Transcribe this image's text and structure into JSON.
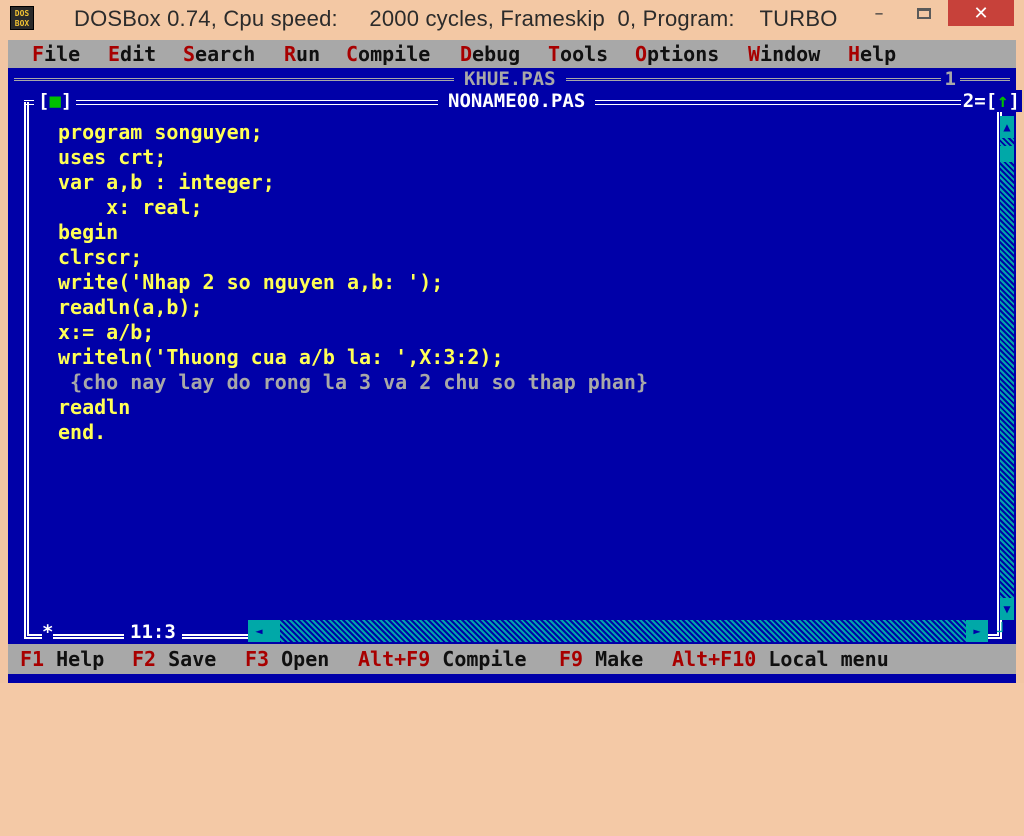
{
  "titlebar": {
    "icon_text": "DOS\nBOX",
    "title": "DOSBox 0.74, Cpu speed:     2000 cycles, Frameskip  0, Program:    TURBO",
    "minimize_label": "–",
    "close_label": "✕"
  },
  "menu": [
    {
      "hot": "F",
      "rest": "ile"
    },
    {
      "hot": "E",
      "rest": "dit"
    },
    {
      "hot": "S",
      "rest": "earch"
    },
    {
      "hot": "R",
      "rest": "un"
    },
    {
      "hot": "C",
      "rest": "ompile"
    },
    {
      "hot": "D",
      "rest": "ebug"
    },
    {
      "hot": "T",
      "rest": "ools"
    },
    {
      "hot": "O",
      "rest": "ptions"
    },
    {
      "hot": "W",
      "rest": "indow"
    },
    {
      "hot": "H",
      "rest": "elp"
    }
  ],
  "back_window": {
    "title": "KHUE.PAS",
    "number": "1"
  },
  "editor": {
    "close_box_left": "[",
    "close_box_mark": "■",
    "close_box_right": "]",
    "title": "NONAME00.PAS",
    "window_number": "2",
    "zoom_left": "[",
    "zoom_mark": "↑",
    "zoom_right": "]",
    "cursor_position": "11:3",
    "modified_marker": "*",
    "code_lines": [
      {
        "text": "program songuyen;",
        "comment": false
      },
      {
        "text": "uses crt;",
        "comment": false
      },
      {
        "text": "var a,b : integer;",
        "comment": false
      },
      {
        "text": "    x: real;",
        "comment": false
      },
      {
        "text": "begin",
        "comment": false
      },
      {
        "text": "clrscr;",
        "comment": false
      },
      {
        "text": "write('Nhap 2 so nguyen a,b: ');",
        "comment": false
      },
      {
        "text": "readln(a,b);",
        "comment": false
      },
      {
        "text": "x:= a/b;",
        "comment": false
      },
      {
        "text": "writeln('Thuong cua a/b la: ',X:3:2);",
        "comment": false
      },
      {
        "text": " {cho nay lay do rong la 3 va 2 chu so thap phan}",
        "comment": true
      },
      {
        "text": "readln",
        "comment": false
      },
      {
        "text": "end.",
        "comment": false
      }
    ]
  },
  "scroll": {
    "up_icon": "▲",
    "down_icon": "▼",
    "left_icon": "◄",
    "right_icon": "►",
    "corner_icon": "┘"
  },
  "fkeys": [
    {
      "key": "F1",
      "label": "Help"
    },
    {
      "key": "F2",
      "label": "Save"
    },
    {
      "key": "F3",
      "label": "Open"
    },
    {
      "key": "Alt+F9",
      "label": "Compile"
    },
    {
      "key": "F9",
      "label": "Make"
    },
    {
      "key": "Alt+F10",
      "label": "Local menu"
    }
  ],
  "colors": {
    "dos_blue": "#0000a8",
    "menu_gray": "#a8a8a8",
    "hotkey_red": "#a80000",
    "code_yellow": "#ffff55",
    "scroll_cyan": "#00a8a8",
    "close_red": "#c7413a"
  }
}
